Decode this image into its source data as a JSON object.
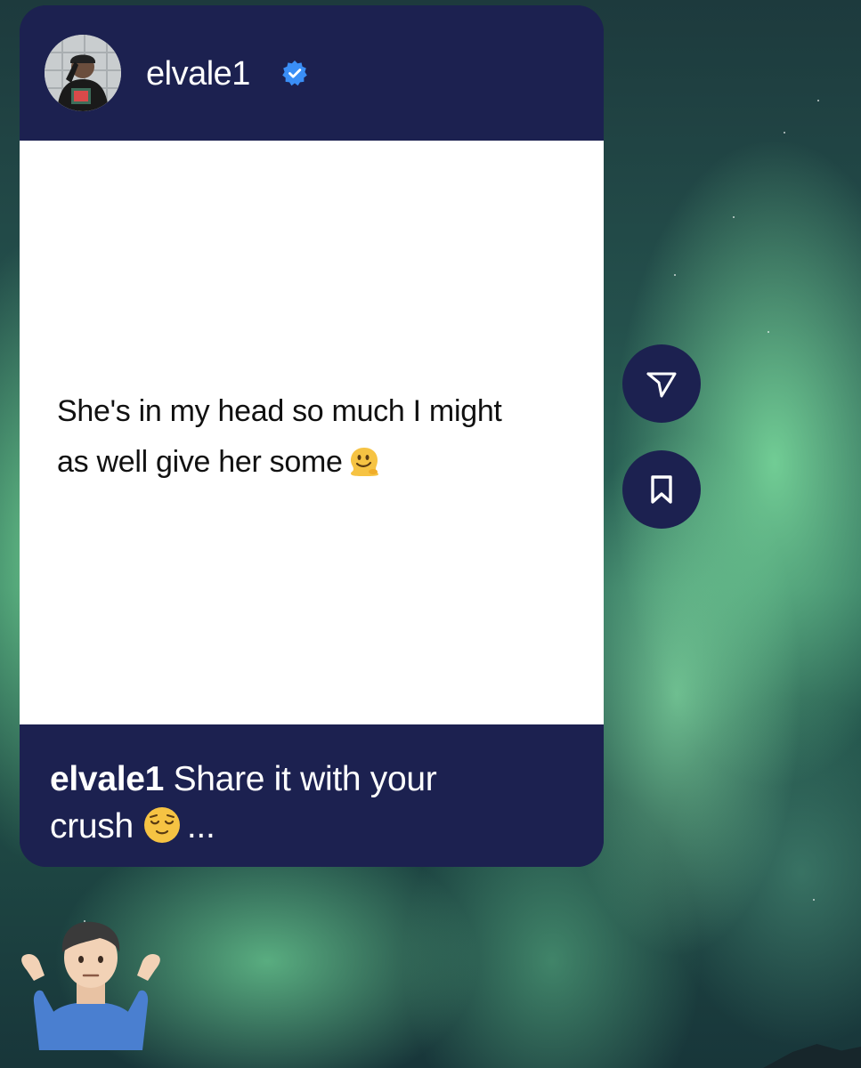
{
  "post": {
    "author": {
      "username": "elvale1",
      "verified": true,
      "avatar": "profile-photo"
    },
    "text_line_1": "She's in my head so much I might",
    "text_line_2": "as well give her some",
    "text_emoji": "melting-face-emoji",
    "caption": {
      "username": "elvale1",
      "text_line_1": "Share it with your",
      "text_line_2": "crush",
      "emoji": "relieved-face-emoji",
      "more": "..."
    }
  },
  "actions": {
    "send_icon": "paper-plane-icon",
    "save_icon": "bookmark-icon"
  },
  "sticker": "person-shrugging-emoji",
  "colors": {
    "card_dark": "#1c2150",
    "card_light": "#ffffff",
    "verified_blue": "#3a8ef6",
    "aurora_green": "#7ee0a0"
  }
}
